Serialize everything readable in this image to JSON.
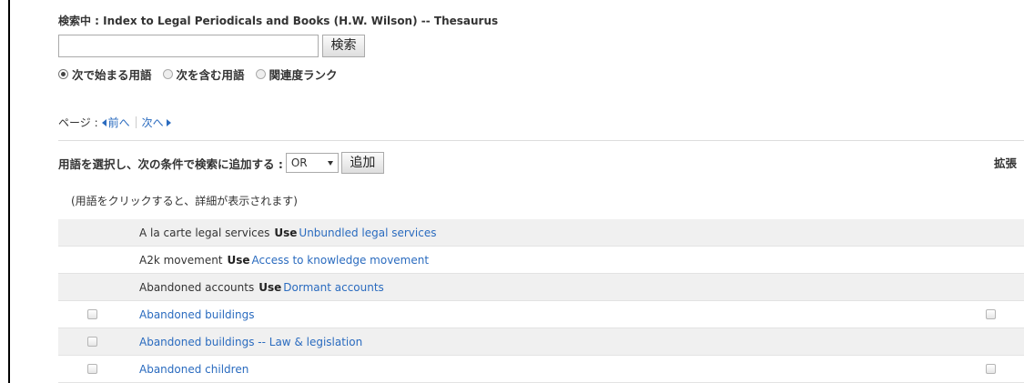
{
  "header": {
    "title": "検索中 : Index to Legal Periodicals and Books (H.W. Wilson) -- Thesaurus"
  },
  "search": {
    "value": "",
    "button_label": "検索",
    "options": [
      {
        "label": "次で始まる用語",
        "checked": true
      },
      {
        "label": "次を含む用語",
        "checked": false
      },
      {
        "label": "関連度ランク",
        "checked": false
      }
    ]
  },
  "paging": {
    "label": "ページ :",
    "prev_label": "前へ",
    "next_label": "次へ"
  },
  "add_bar": {
    "label": "用語を選択し、次の条件で検索に追加する :",
    "operator": "OR",
    "button_label": "追加",
    "expand_label": "拡張"
  },
  "hint": "(用語をクリックすると、詳細が表示されます)",
  "terms": [
    {
      "text": "A la carte legal services",
      "use_label": "Use",
      "use_target": "Unbundled legal services"
    },
    {
      "text": "A2k movement",
      "use_label": "Use",
      "use_target": "Access to knowledge movement"
    },
    {
      "text": "Abandoned accounts",
      "use_label": "Use",
      "use_target": "Dormant accounts"
    },
    {
      "link": "Abandoned buildings",
      "expand_checkbox": true
    },
    {
      "link": "Abandoned buildings -- Law & legislation",
      "expand_checkbox": false
    },
    {
      "link": "Abandoned children",
      "expand_checkbox": true
    }
  ],
  "colors": {
    "link": "#2a6bbf",
    "row_shade": "#f0f0f0"
  }
}
